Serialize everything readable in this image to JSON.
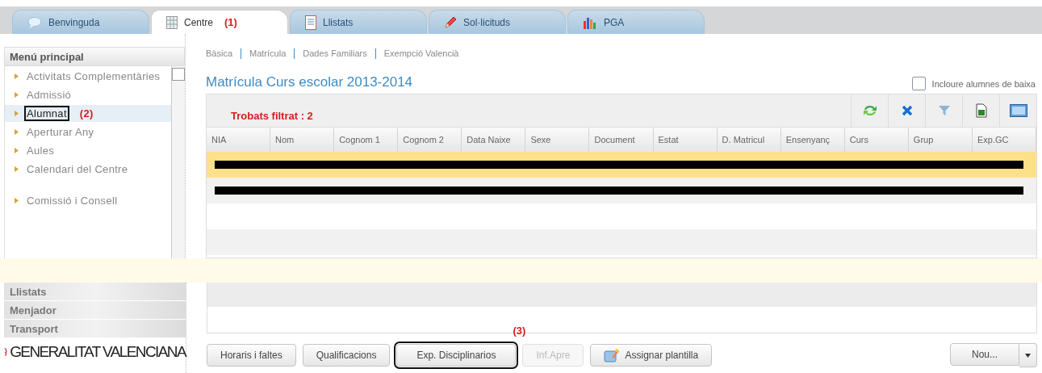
{
  "tabs": [
    {
      "label": "Benvinguda",
      "selected": false
    },
    {
      "label": "Centre",
      "selected": true,
      "annotation": "(1)"
    },
    {
      "label": "Llistats",
      "selected": false
    },
    {
      "label": "Sol·licituds",
      "selected": false
    },
    {
      "label": "PGA",
      "selected": false
    }
  ],
  "sidebar": {
    "title": "Menú principal",
    "items": [
      {
        "label": "Activitats Complementàries",
        "selected": false,
        "boxed": false
      },
      {
        "label": "Admissió",
        "selected": false,
        "boxed": false
      },
      {
        "label": "Alumnat",
        "selected": true,
        "boxed": true,
        "annotation": "(2)"
      },
      {
        "label": "Aperturar Any",
        "selected": false,
        "boxed": false
      },
      {
        "label": "Aules",
        "selected": false,
        "boxed": false
      },
      {
        "label": "Calendari del Centre",
        "selected": false,
        "boxed": false
      },
      {
        "label": "Comissió i Consell",
        "selected": false,
        "boxed": false
      }
    ],
    "sections": [
      "Llistats",
      "Menjador",
      "Transport"
    ],
    "logo": "GENERALITAT VALENCIANA"
  },
  "subnav": [
    "Bàsica",
    "Matrícula",
    "Dades Familiars",
    "Exempció Valencià"
  ],
  "title": "Matrícula Curs escolar 2013-2014",
  "include_dropped": {
    "label": "Incloure alumnes de baixa",
    "checked": false
  },
  "table": {
    "found": "Trobats filtrat : 2",
    "columns": [
      "NIA",
      "Nom",
      "Cognom 1",
      "Cognom 2",
      "Data Naixe",
      "Sexe",
      "Document",
      "Estat",
      "D. Matricul",
      "Ensenyanç",
      "Curs",
      "Grup",
      "Exp.GC"
    ],
    "rows": [
      {
        "selected": true,
        "redacted": true
      },
      {
        "selected": false,
        "redacted": true
      }
    ]
  },
  "buttons": [
    {
      "label": "Horaris i faltes",
      "kind": "plain",
      "disabled": false,
      "boxed": false
    },
    {
      "label": "Qualificacions",
      "kind": "plain",
      "disabled": false,
      "boxed": false
    },
    {
      "label": "Exp. Disciplinarios",
      "kind": "plain",
      "disabled": false,
      "boxed": true,
      "annotation": "(3)"
    },
    {
      "label": "Inf.Apre",
      "kind": "plain",
      "disabled": true,
      "boxed": false
    },
    {
      "label": "Assignar plantilla",
      "kind": "icon",
      "disabled": false,
      "boxed": false
    },
    {
      "label": "Nou...",
      "kind": "split",
      "disabled": false,
      "boxed": false
    }
  ]
}
